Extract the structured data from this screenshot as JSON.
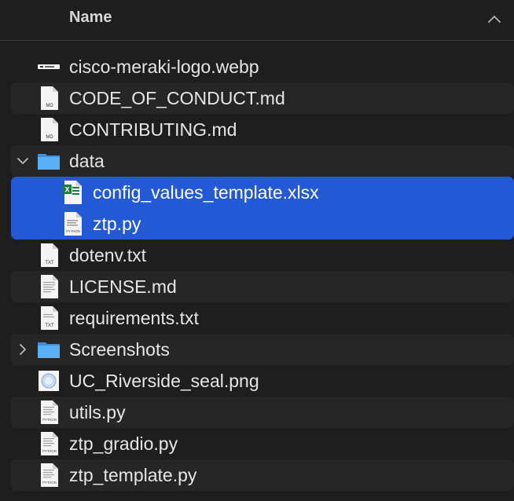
{
  "header": {
    "name_column": "Name"
  },
  "files": [
    {
      "name": "cisco-meraki-logo.webp",
      "icon": "webp-image-icon"
    },
    {
      "name": "CODE_OF_CONDUCT.md",
      "icon": "markdown-file-icon",
      "badge": "MD"
    },
    {
      "name": "CONTRIBUTING.md",
      "icon": "markdown-file-icon",
      "badge": "MD"
    },
    {
      "name": "data",
      "icon": "folder-icon",
      "expanded": true
    },
    {
      "name": "config_values_template.xlsx",
      "icon": "excel-file-icon",
      "selected": true
    },
    {
      "name": "ztp.py",
      "icon": "python-file-icon",
      "badge": "PYTHON",
      "selected": true
    },
    {
      "name": "dotenv.txt",
      "icon": "text-file-icon",
      "badge": "TXT"
    },
    {
      "name": "LICENSE.md",
      "icon": "document-icon"
    },
    {
      "name": "requirements.txt",
      "icon": "text-file-icon",
      "badge": "TXT"
    },
    {
      "name": "Screenshots",
      "icon": "folder-icon",
      "expanded": false
    },
    {
      "name": "UC_Riverside_seal.png",
      "icon": "png-image-icon"
    },
    {
      "name": "utils.py",
      "icon": "python-file-icon",
      "badge": "PYTHON"
    },
    {
      "name": "ztp_gradio.py",
      "icon": "python-file-icon",
      "badge": "PYTHON"
    },
    {
      "name": "ztp_template.py",
      "icon": "python-file-icon",
      "badge": "PYTHON"
    }
  ],
  "colors": {
    "background": "#1e1e1e",
    "alternate_row": "#262626",
    "selection": "#2459d5",
    "folder": "#4aa3f0",
    "excel_green": "#1f7a44"
  }
}
